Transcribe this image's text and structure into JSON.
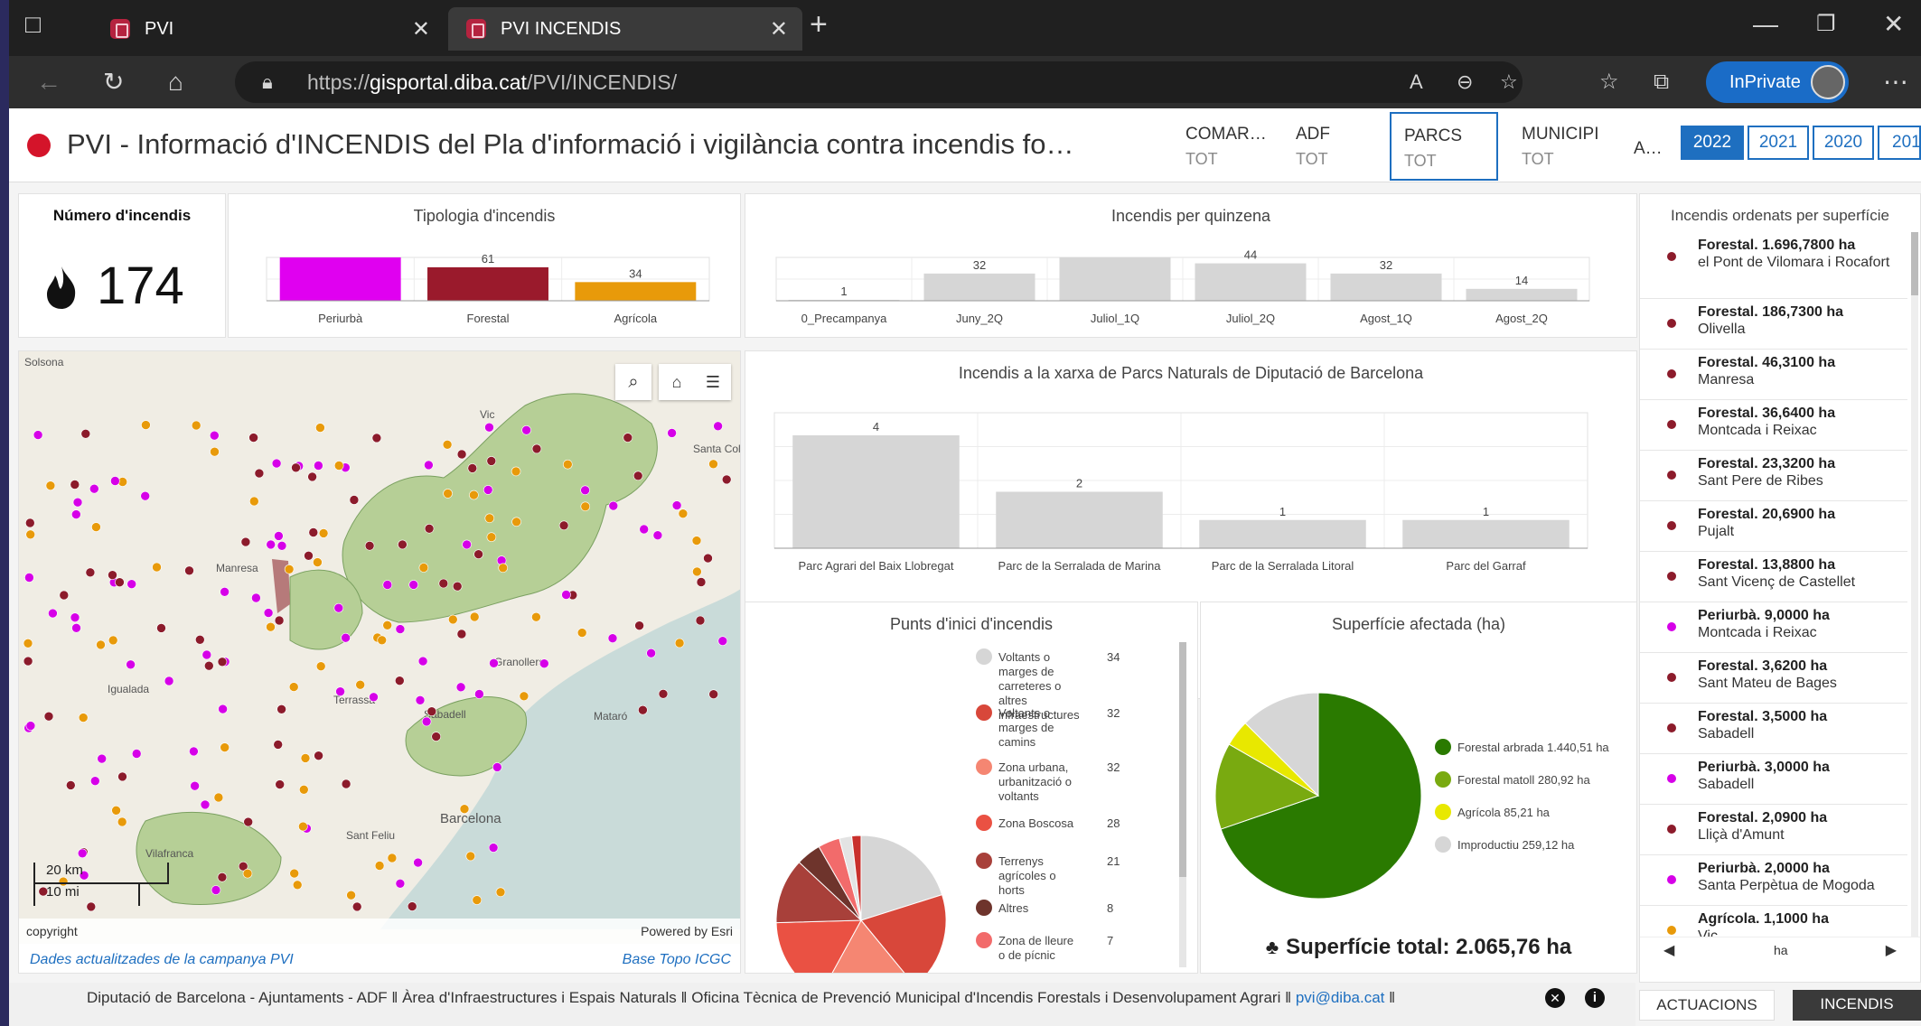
{
  "browser": {
    "tabs": [
      {
        "label": "PVI"
      },
      {
        "label": "PVI INCENDIS"
      }
    ],
    "url_prefix": "https://",
    "url_domain": "gisportal.diba.cat",
    "url_path": "/PVI/INCENDIS/",
    "inprivate_label": "InPrivate"
  },
  "header": {
    "title": "PVI - Informació d'INCENDIS del Pla d'informació i vigilància contra incendis fo…",
    "selectors": [
      {
        "label": "COMAR…",
        "value": "TOT"
      },
      {
        "label": "ADF",
        "value": "TOT"
      },
      {
        "label": "PARCS",
        "value": "TOT"
      },
      {
        "label": "MUNICIPI",
        "value": "TOT"
      },
      {
        "label": "A…",
        "value": ""
      }
    ],
    "years": [
      "2022",
      "2021",
      "2020",
      "201"
    ]
  },
  "indicator": {
    "title": "Número d'incendis",
    "value": "174"
  },
  "map": {
    "place_labels": [
      "Solsona",
      "Vic",
      "Santa Coloma de Farners",
      "Manresa",
      "Granollers",
      "Terrassa",
      "Sabadell",
      "Mataró",
      "Igualada",
      "Barcelona",
      "Sant Feliu de Llobregat",
      "Vilafranca"
    ],
    "scale_km": "20 km",
    "scale_mi": "10 mi",
    "copyright": "copyright",
    "powered": "Powered by Esri",
    "link_left": "Dades actualitzades de la campanya PVI",
    "link_right": "Base Topo ICGC"
  },
  "tipologia": {
    "title": "Tipologia d'incendis",
    "chart_data": {
      "type": "bar",
      "categories": [
        "Periurbà",
        "Forestal",
        "Agrícola"
      ],
      "values": [
        79,
        61,
        34
      ],
      "data_labels": [
        "",
        "61",
        "34"
      ],
      "colors": [
        "#e000f0",
        "#9a1a2c",
        "#e89a0a"
      ],
      "ylim": [
        0,
        79
      ]
    }
  },
  "quinzena": {
    "title": "Incendis per quinzena",
    "chart_data": {
      "type": "bar",
      "categories": [
        "0_Precampanya",
        "Juny_2Q",
        "Juliol_1Q",
        "Juliol_2Q",
        "Agost_1Q",
        "Agost_2Q"
      ],
      "values": [
        1,
        32,
        51,
        44,
        32,
        14
      ],
      "data_labels": [
        "1",
        "32",
        "",
        "44",
        "32",
        "14"
      ],
      "ylim": [
        0,
        51
      ]
    }
  },
  "parcs": {
    "title": "Incendis a la xarxa de Parcs Naturals de Diputació de Barcelona",
    "chart_data": {
      "type": "bar",
      "categories": [
        "Parc Agrari del Baix Llobregat",
        "Parc de la Serralada de Marina",
        "Parc de la Serralada Litoral",
        "Parc del Garraf"
      ],
      "values": [
        4,
        2,
        1,
        1
      ],
      "ylim": [
        0,
        4.8
      ]
    }
  },
  "punts": {
    "title": "Punts d'inici d'incendis",
    "chart_data": {
      "type": "pie",
      "slices": [
        {
          "label": "Voltants o marges de carreteres o altres infraestructures",
          "value": 34,
          "color": "#d6d6d6"
        },
        {
          "label": "Voltants o marges de camins",
          "value": 32,
          "color": "#d8473a"
        },
        {
          "label": "Zona urbana, urbanització o voltants",
          "value": 32,
          "color": "#f58672"
        },
        {
          "label": "Zona Boscosa",
          "value": 28,
          "color": "#ea5143"
        },
        {
          "label": "Terrenys agrícoles o horts",
          "value": 21,
          "color": "#a8403a"
        },
        {
          "label": "Altres",
          "value": 8,
          "color": "#6e342c"
        },
        {
          "label": "Zona de lleure o de pícnic",
          "value": 7,
          "color": "#f26b6b"
        },
        {
          "label": "",
          "value": 4,
          "color": "#e3e3e3"
        },
        {
          "label": "",
          "value": 3,
          "color": "#c9302c"
        }
      ]
    }
  },
  "superficie": {
    "title": "Superfície afectada (ha)",
    "total": "Superfície total: 2.065,76 ha",
    "chart_data": {
      "type": "pie",
      "slices": [
        {
          "label": "Forestal arbrada",
          "value_label": "1.440,51 ha",
          "value": 1440.51,
          "color": "#2a7a00"
        },
        {
          "label": "Forestal matoll",
          "value_label": "280,92 ha",
          "value": 280.92,
          "color": "#79aa10"
        },
        {
          "label": "Agrícola",
          "value_label": "85,21 ha",
          "value": 85.21,
          "color": "#e8e800"
        },
        {
          "label": "Improductiu",
          "value_label": "259,12 ha",
          "value": 259.12,
          "color": "#d6d6d6"
        }
      ]
    }
  },
  "list": {
    "title": "Incendis ordenats per superfície",
    "items": [
      {
        "head": "Forestal. 1.696,7800 ha",
        "place": "el Pont de Vilomara i Rocafort",
        "color": "#8c1b2b"
      },
      {
        "head": "Forestal. 186,7300 ha",
        "place": "Olivella",
        "color": "#8c1b2b"
      },
      {
        "head": "Forestal. 46,3100 ha",
        "place": "Manresa",
        "color": "#8c1b2b"
      },
      {
        "head": "Forestal. 36,6400 ha",
        "place": "Montcada i Reixac",
        "color": "#8c1b2b"
      },
      {
        "head": "Forestal. 23,3200 ha",
        "place": "Sant Pere de Ribes",
        "color": "#8c1b2b"
      },
      {
        "head": "Forestal. 20,6900 ha",
        "place": "Pujalt",
        "color": "#8c1b2b"
      },
      {
        "head": "Forestal. 13,8800 ha",
        "place": "Sant Vicenç de Castellet",
        "color": "#8c1b2b"
      },
      {
        "head": "Periurbà. 9,0000 ha",
        "place": "Montcada i Reixac",
        "color": "#d600e8"
      },
      {
        "head": "Forestal. 3,6200 ha",
        "place": "Sant Mateu de Bages",
        "color": "#8c1b2b"
      },
      {
        "head": "Forestal. 3,5000 ha",
        "place": "Sabadell",
        "color": "#8c1b2b"
      },
      {
        "head": "Periurbà. 3,0000 ha",
        "place": "Sabadell",
        "color": "#d600e8"
      },
      {
        "head": "Forestal. 2,0900 ha",
        "place": "Lliçà d'Amunt",
        "color": "#8c1b2b"
      },
      {
        "head": "Periurbà. 2,0000 ha",
        "place": "Santa Perpètua de Mogoda",
        "color": "#d600e8"
      },
      {
        "head": "Agrícola. 1,1000 ha",
        "place": "Vic",
        "color": "#e89a0a"
      }
    ],
    "pager_label": "ha"
  },
  "footer": {
    "text": "Diputació de Barcelona - Ajuntaments - ADF ‖ Àrea d'Infraestructures i Espais Naturals ‖ Oficina Tècnica de Prevenció Municipal d'Incendis Forestals i Desenvolupament Agrari ‖",
    "email": "pvi@diba.cat",
    "tail": "‖",
    "tabs": [
      "ACTUACIONS",
      "INCENDIS"
    ]
  }
}
